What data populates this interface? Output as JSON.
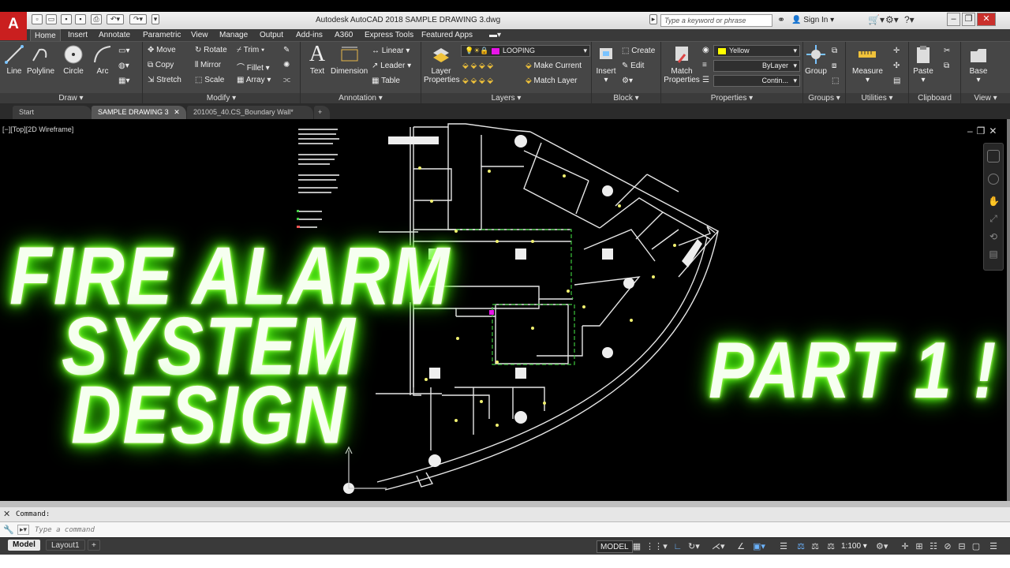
{
  "app": {
    "logo": "A",
    "window_title": "Autodesk AutoCAD 2018   SAMPLE DRAWING 3.dwg",
    "search_placeholder": "Type a keyword or phrase",
    "sign_in": "Sign In"
  },
  "ribbon_tabs": [
    "Home",
    "Insert",
    "Annotate",
    "Parametric",
    "View",
    "Manage",
    "Output",
    "Add-ins",
    "A360",
    "Express Tools",
    "Featured Apps"
  ],
  "ribbon": {
    "draw": {
      "label": "Draw",
      "tools": [
        "Line",
        "Polyline",
        "Circle",
        "Arc"
      ]
    },
    "modify": {
      "label": "Modify",
      "tools": [
        "Move",
        "Rotate",
        "Trim",
        "Copy",
        "Mirror",
        "Fillet",
        "Stretch",
        "Scale",
        "Array"
      ]
    },
    "annotation": {
      "label": "Annotation",
      "text": "Text",
      "dimension": "Dimension",
      "linear": "Linear",
      "leader": "Leader",
      "table": "Table"
    },
    "layers": {
      "label": "Layers",
      "layer_properties": "Layer Properties",
      "current_layer": "LOOPING",
      "current_layer_color": "#e815e8",
      "make_current": "Make Current",
      "match_layer": "Match Layer"
    },
    "block": {
      "label": "Block",
      "insert": "Insert",
      "create": "Create",
      "edit": "Edit"
    },
    "properties": {
      "label": "Properties",
      "match": "Match Properties",
      "color": "Yellow",
      "color_hex": "#ffff00",
      "lineweight": "ByLayer",
      "linetype": "Contin..."
    },
    "groups": {
      "label": "Groups",
      "group": "Group"
    },
    "utilities": {
      "label": "Utilities",
      "measure": "Measure"
    },
    "clipboard": {
      "label": "Clipboard",
      "paste": "Paste"
    },
    "view": {
      "label": "View",
      "base": "Base"
    }
  },
  "file_tabs": [
    "Start",
    "SAMPLE DRAWING 3",
    "201005_40.CS_Boundary Wall*"
  ],
  "viewport_label": "[−][Top][2D Wireframe]",
  "overlay": {
    "line1": "FIRE ALARM",
    "line2": "SYSTEM",
    "line3": "DESIGN",
    "part": "PART 1 !",
    "glow_color": "#4dff10"
  },
  "command": {
    "history": "Command:",
    "placeholder": "Type a command"
  },
  "layout_tabs": [
    "Model",
    "Layout1"
  ],
  "status": {
    "mode": "MODEL",
    "scale": "1:100"
  }
}
